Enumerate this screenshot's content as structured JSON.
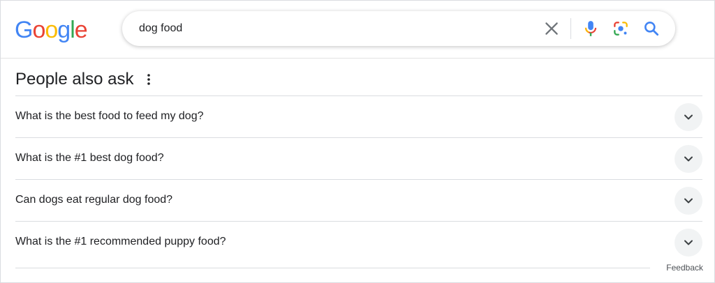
{
  "logo": {
    "text": "Google",
    "colors": [
      "#4285F4",
      "#EA4335",
      "#FBBC05",
      "#4285F4",
      "#34A853",
      "#EA4335"
    ]
  },
  "search": {
    "value": "dog food",
    "icons": {
      "clear": "close-icon",
      "voice": "microphone-icon",
      "lens": "camera-lens-icon",
      "submit": "search-icon"
    }
  },
  "paa": {
    "title": "People also ask",
    "menu_icon": "more-vert-icon",
    "questions": [
      "What is the best food to feed my dog?",
      "What is the #1 best dog food?",
      "Can dogs eat regular dog food?",
      "What is the #1 recommended puppy food?"
    ]
  },
  "feedback": "Feedback",
  "colors": {
    "text": "#202124",
    "divider": "#dadce0",
    "chevron_bg": "#f1f3f4",
    "search_icon": "#4285F4",
    "clear_icon": "#70757a"
  }
}
